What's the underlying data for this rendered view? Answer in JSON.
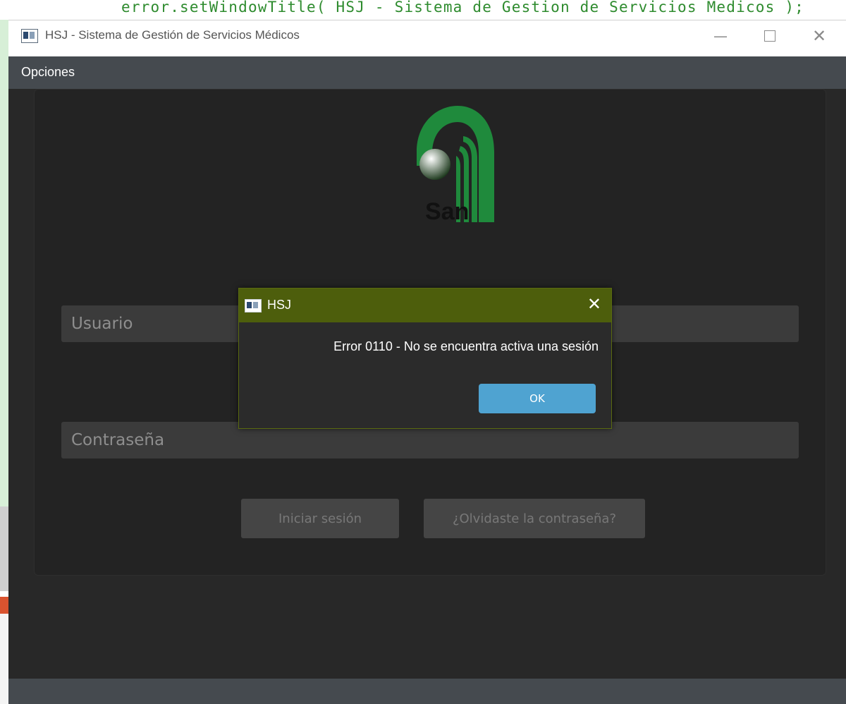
{
  "background_code": "error.setWindowTitle( HSJ - Sistema de Gestion de Servicios Medicos );",
  "window": {
    "title": "HSJ - Sistema de Gestión de Servicios Médicos",
    "controls": {
      "minimize": "—",
      "maximize": "",
      "close": "✕"
    }
  },
  "menubar": {
    "items": [
      "Opciones"
    ]
  },
  "login": {
    "logo_text": "San",
    "username_placeholder": "Usuario",
    "password_placeholder": "Contraseña",
    "login_button": "Iniciar sesión",
    "forgot_button": "¿Olvidaste la contraseña?"
  },
  "dialog": {
    "title": "HSJ",
    "message": "Error 0110 - No se encuentra activa una sesión",
    "ok_button": "OK",
    "close": "✕"
  },
  "colors": {
    "window_bg": "#2b2b2b",
    "menubar_bg": "#454a4f",
    "dialog_title_bg": "#4d5e0c",
    "ok_button_bg": "#4fa3d1",
    "logo_green": "#1f8a3c"
  },
  "icons": [
    "app-icon",
    "minimize-icon",
    "maximize-icon",
    "close-icon",
    "hospital-logo",
    "dialog-app-icon",
    "dialog-close-icon"
  ]
}
